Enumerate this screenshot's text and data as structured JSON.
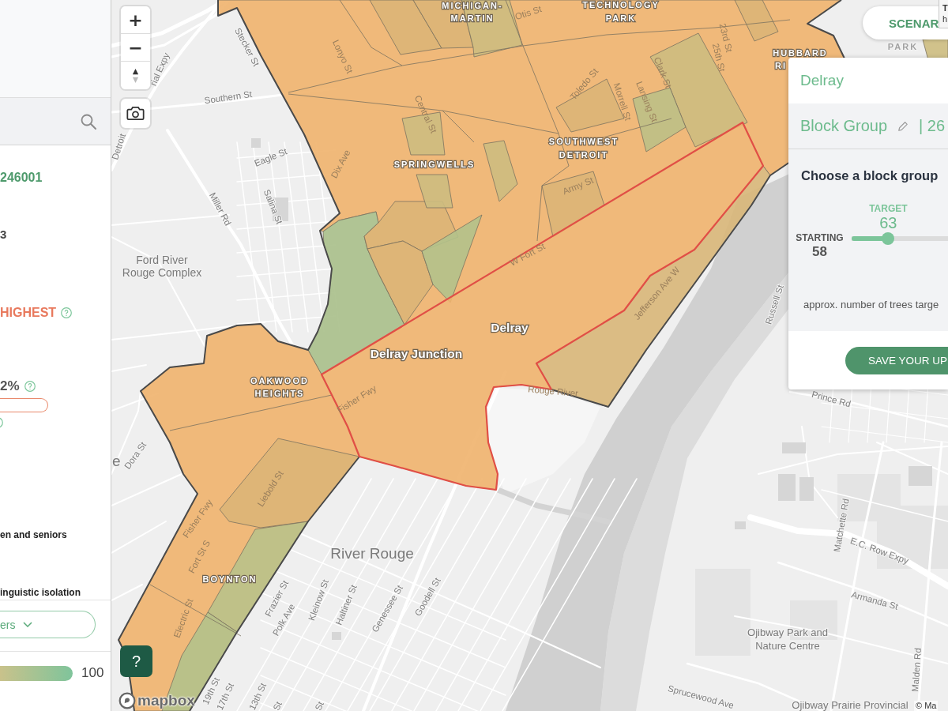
{
  "sidebar": {
    "block_group_id": "246001",
    "value_2": "3",
    "priority": "HIGHEST",
    "percent": "2%",
    "indicators": [
      "en and seniors",
      "inguistic isolation"
    ],
    "filter_button": "ers",
    "legend_max": "100"
  },
  "map": {
    "zoom_in": "+",
    "zoom_out": "−",
    "help_button": "?",
    "logo_text": "mapbox",
    "attribution": "© Ma",
    "neighborhood_labels": [
      {
        "lines": [
          "MICHIGAN-",
          "MARTIN"
        ],
        "kind": "overlay"
      },
      {
        "lines": [
          "TECHNOLOGY",
          "PARK"
        ],
        "kind": "overlay"
      },
      {
        "lines": [
          "HUBBARD",
          "RI"
        ],
        "kind": "overlay"
      },
      {
        "lines": [
          "SPRINGWELLS"
        ],
        "kind": "overlay"
      },
      {
        "lines": [
          "SOUTHWEST",
          "DETROIT"
        ],
        "kind": "overlay"
      },
      {
        "lines": [
          "OAKWOOD",
          "HEIGHTS"
        ],
        "kind": "overlay"
      },
      {
        "lines": [
          "BOYNTON"
        ],
        "kind": "overlay"
      },
      {
        "lines": [
          "PARK"
        ],
        "kind": "base"
      }
    ],
    "place_labels": [
      {
        "lines": [
          "Ford River",
          "Rouge Complex"
        ],
        "kind": "base"
      },
      {
        "lines": [
          "Delray"
        ],
        "kind": "overlay"
      },
      {
        "lines": [
          "Delray Junction"
        ],
        "kind": "overlay"
      },
      {
        "lines": [
          "River Rouge"
        ],
        "kind": "base"
      },
      {
        "lines": [
          "Ojibway Park and",
          "Nature Centre"
        ],
        "kind": "base"
      },
      {
        "lines": [
          "Ojibway Prairie Provincial"
        ],
        "kind": "base"
      },
      {
        "lines": [
          "e"
        ],
        "kind": "base"
      }
    ],
    "street_labels": [
      "rial Expy",
      "Detroit",
      "Stecker St",
      "Southern St",
      "Eagle St",
      "Lonyo St",
      "Otis St",
      "23rd St",
      "25th St",
      "Clark St",
      "Toledo St",
      "Morrell St",
      "Lansing St",
      "Central St",
      "Dix Ave",
      "Army St",
      "Miller Rd",
      "Salina St",
      "W Fort St",
      "Jefferson Ave W",
      "Russell St",
      "Fisher Fwy",
      "Rouge River",
      "Prince Rd",
      "Dora St",
      "Liebold St",
      "Fisher Fwy",
      "Fort St S",
      "Electric St",
      "Frazier St",
      "Polk Ave",
      "Kleinow St",
      "Haltiner St",
      "Genessee St",
      "Goodell St",
      "Matchette Rd",
      "E.C. Row Expy",
      "Armanda St",
      "Malden Rd",
      "19th St",
      "17th St",
      "13th St",
      "St",
      "St",
      "Sprucewood Ave"
    ]
  },
  "scenario_button": "SCENAR",
  "tooltip": {
    "title": "T",
    "text": "h"
  },
  "panel": {
    "title": "Delray",
    "block_group_label": "Block Group",
    "block_group_id": "| 26",
    "heading": "Choose a block group",
    "target": {
      "label": "TARGET",
      "value": "63"
    },
    "starting": {
      "label": "STARTING",
      "value": "58"
    },
    "slider": {
      "level": 0.38
    },
    "note": "approx. number of trees targe",
    "save_button": "SAVE YOUR UP"
  }
}
